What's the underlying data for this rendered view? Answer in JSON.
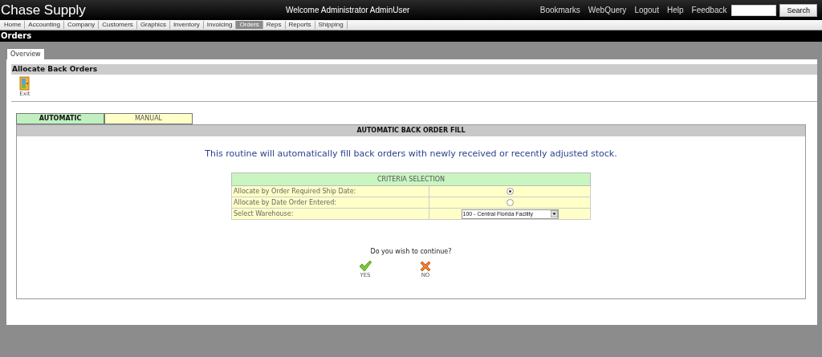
{
  "app": {
    "title": "Chase Supply",
    "welcome": "Welcome  Administrator AdminUser",
    "links": [
      "Bookmarks",
      "WebQuery",
      "Logout",
      "Help",
      "Feedback"
    ],
    "search_button": "Search"
  },
  "nav": [
    {
      "label": "Home",
      "selected": false
    },
    {
      "label": "Accounting",
      "selected": false
    },
    {
      "label": "Company",
      "selected": false
    },
    {
      "label": "Customers",
      "selected": false
    },
    {
      "label": "Graphics",
      "selected": false
    },
    {
      "label": "Inventory",
      "selected": false
    },
    {
      "label": "Invoicing",
      "selected": false
    },
    {
      "label": "Orders",
      "selected": true
    },
    {
      "label": "Reps",
      "selected": false
    },
    {
      "label": "Reports",
      "selected": false
    },
    {
      "label": "Shipping",
      "selected": false
    }
  ],
  "section_title": "Orders",
  "page_tabs": [
    {
      "label": "Overview",
      "selected": true
    }
  ],
  "panel_title": "Allocate Back Orders",
  "toolbar": [
    {
      "kind": "exit",
      "label": "Exit"
    }
  ],
  "mode_tabs": [
    {
      "label": "AUTOMATIC",
      "selected": true
    },
    {
      "label": "MANUAL",
      "selected": false
    }
  ],
  "fill_title": "AUTOMATIC BACK ORDER FILL",
  "message": "This routine will automatically fill back orders with newly received or recently adjusted stock.",
  "criteria": {
    "title": "CRITERIA SELECTION",
    "rows": [
      {
        "kind": "radio",
        "label": "Allocate by Order Required Ship Date:",
        "selected": true
      },
      {
        "kind": "radio",
        "label": "Allocate by Date Order Entered:",
        "selected": false
      },
      {
        "kind": "select",
        "label": "Select Warehouse:",
        "value": "100 - Central Florida Facility"
      }
    ]
  },
  "prompt": "Do you wish to continue?",
  "actions": [
    {
      "kind": "yes",
      "label": "YES"
    },
    {
      "kind": "no",
      "label": "NO"
    }
  ]
}
